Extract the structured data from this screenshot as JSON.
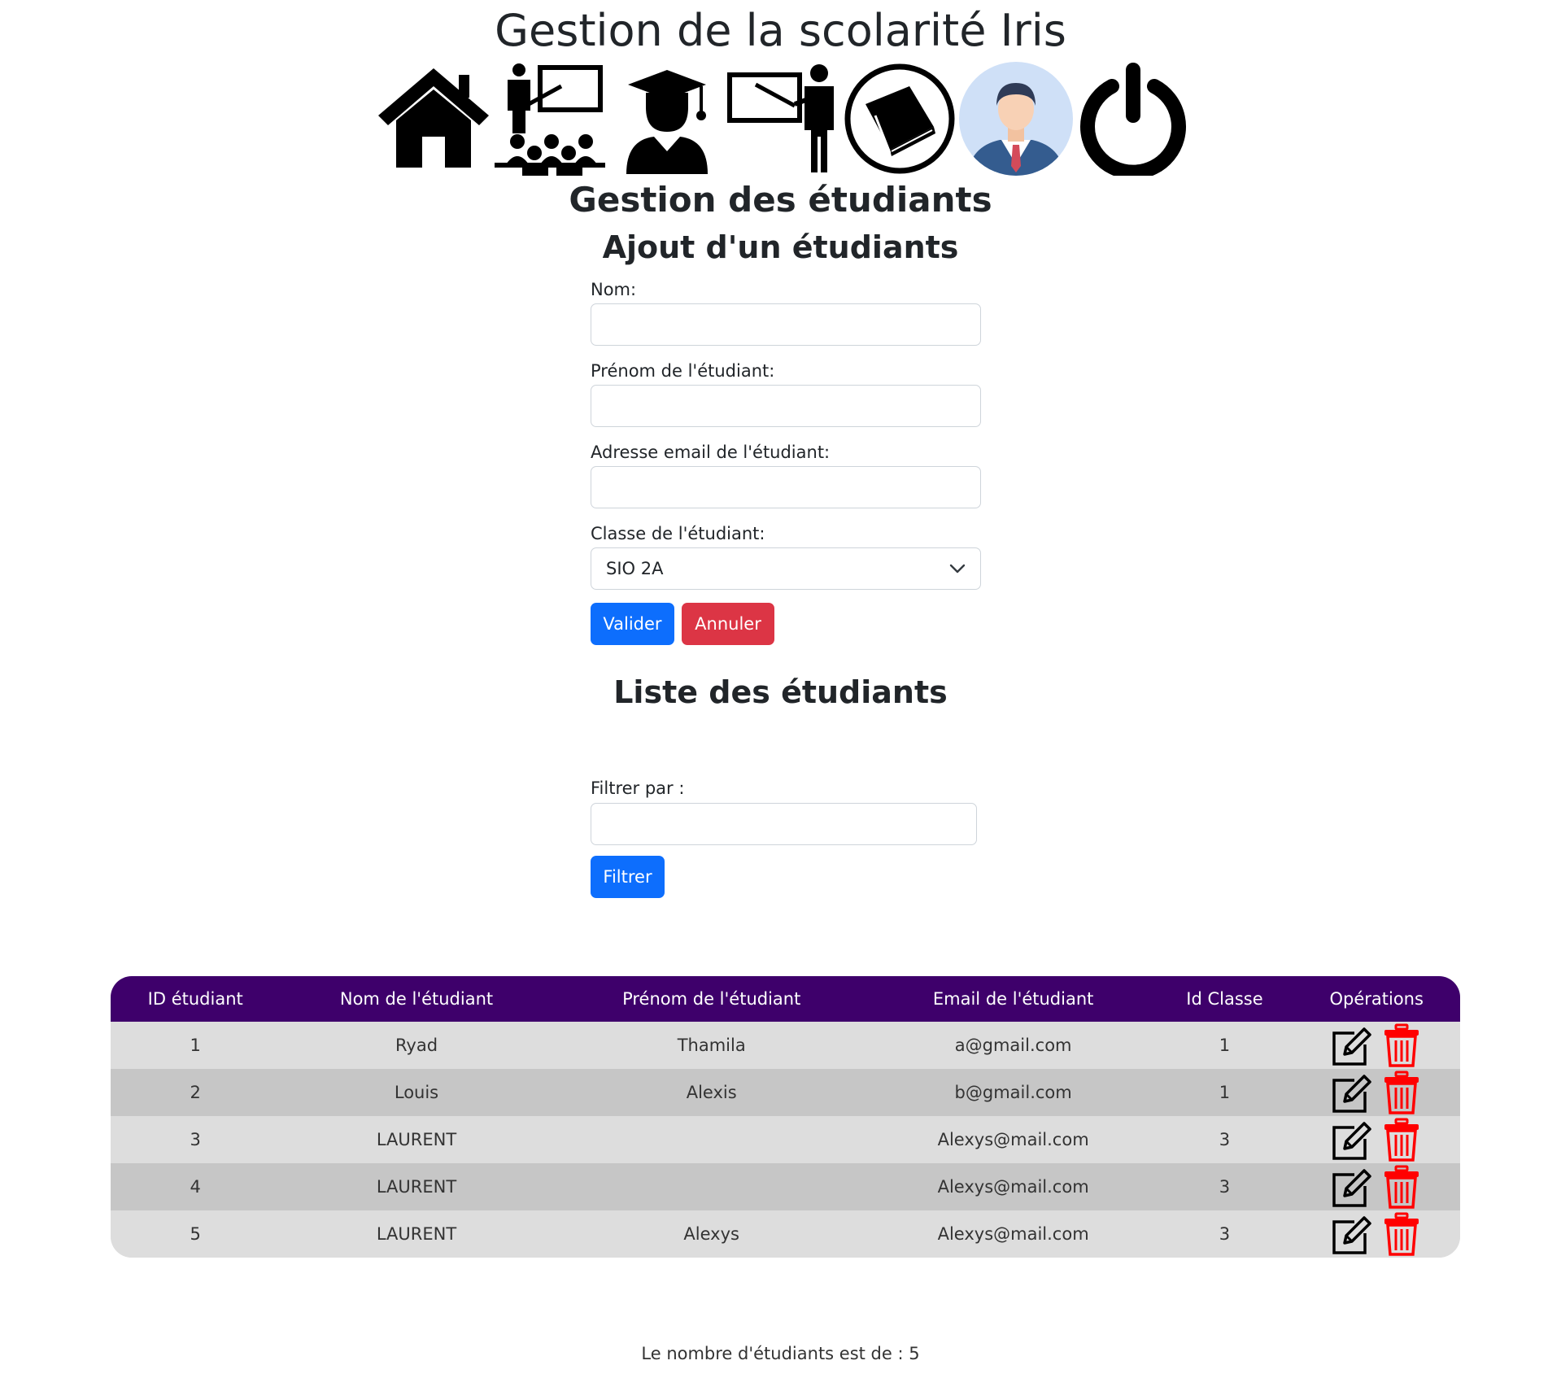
{
  "header": {
    "title": "Gestion de la scolarité Iris"
  },
  "nav": [
    {
      "icon": "home-icon"
    },
    {
      "icon": "classroom-icon"
    },
    {
      "icon": "graduate-student-icon"
    },
    {
      "icon": "teacher-icon"
    },
    {
      "icon": "book-icon"
    },
    {
      "icon": "user-avatar-icon"
    },
    {
      "icon": "power-icon"
    }
  ],
  "page": {
    "title": "Gestion des étudiants"
  },
  "add_form": {
    "title": "Ajout d'un étudiants",
    "nom_label": "Nom:",
    "nom_value": "",
    "prenom_label": "Prénom de l'étudiant:",
    "prenom_value": "",
    "email_label": "Adresse email de l'étudiant:",
    "email_value": "",
    "classe_label": "Classe de l'étudiant:",
    "classe_selected": "SIO 2A",
    "submit_label": "Valider",
    "cancel_label": "Annuler"
  },
  "list": {
    "title": "Liste des étudiants",
    "filter_label": "Filtrer par :",
    "filter_value": "",
    "filter_button": "Filtrer"
  },
  "table": {
    "columns": [
      "ID étudiant",
      "Nom de l'étudiant",
      "Prénom de l'étudiant",
      "Email de l'étudiant",
      "Id Classe",
      "Opérations"
    ],
    "rows": [
      [
        "1",
        "Ryad",
        "Thamila",
        "a@gmail.com",
        "1"
      ],
      [
        "2",
        "Louis",
        "Alexis",
        "b@gmail.com",
        "1"
      ],
      [
        "3",
        "LAURENT",
        "",
        "Alexys@mail.com",
        "3"
      ],
      [
        "4",
        "LAURENT",
        "",
        "Alexys@mail.com",
        "3"
      ],
      [
        "5",
        "LAURENT",
        "Alexys",
        "Alexys@mail.com",
        "3"
      ]
    ]
  },
  "footer": {
    "count_text": "Le nombre d'étudiants est de : 5"
  },
  "colors": {
    "header_bg": "#3e006b",
    "primary": "#0d6efd",
    "danger": "#dc3545",
    "delete_icon": "#ff0000"
  }
}
